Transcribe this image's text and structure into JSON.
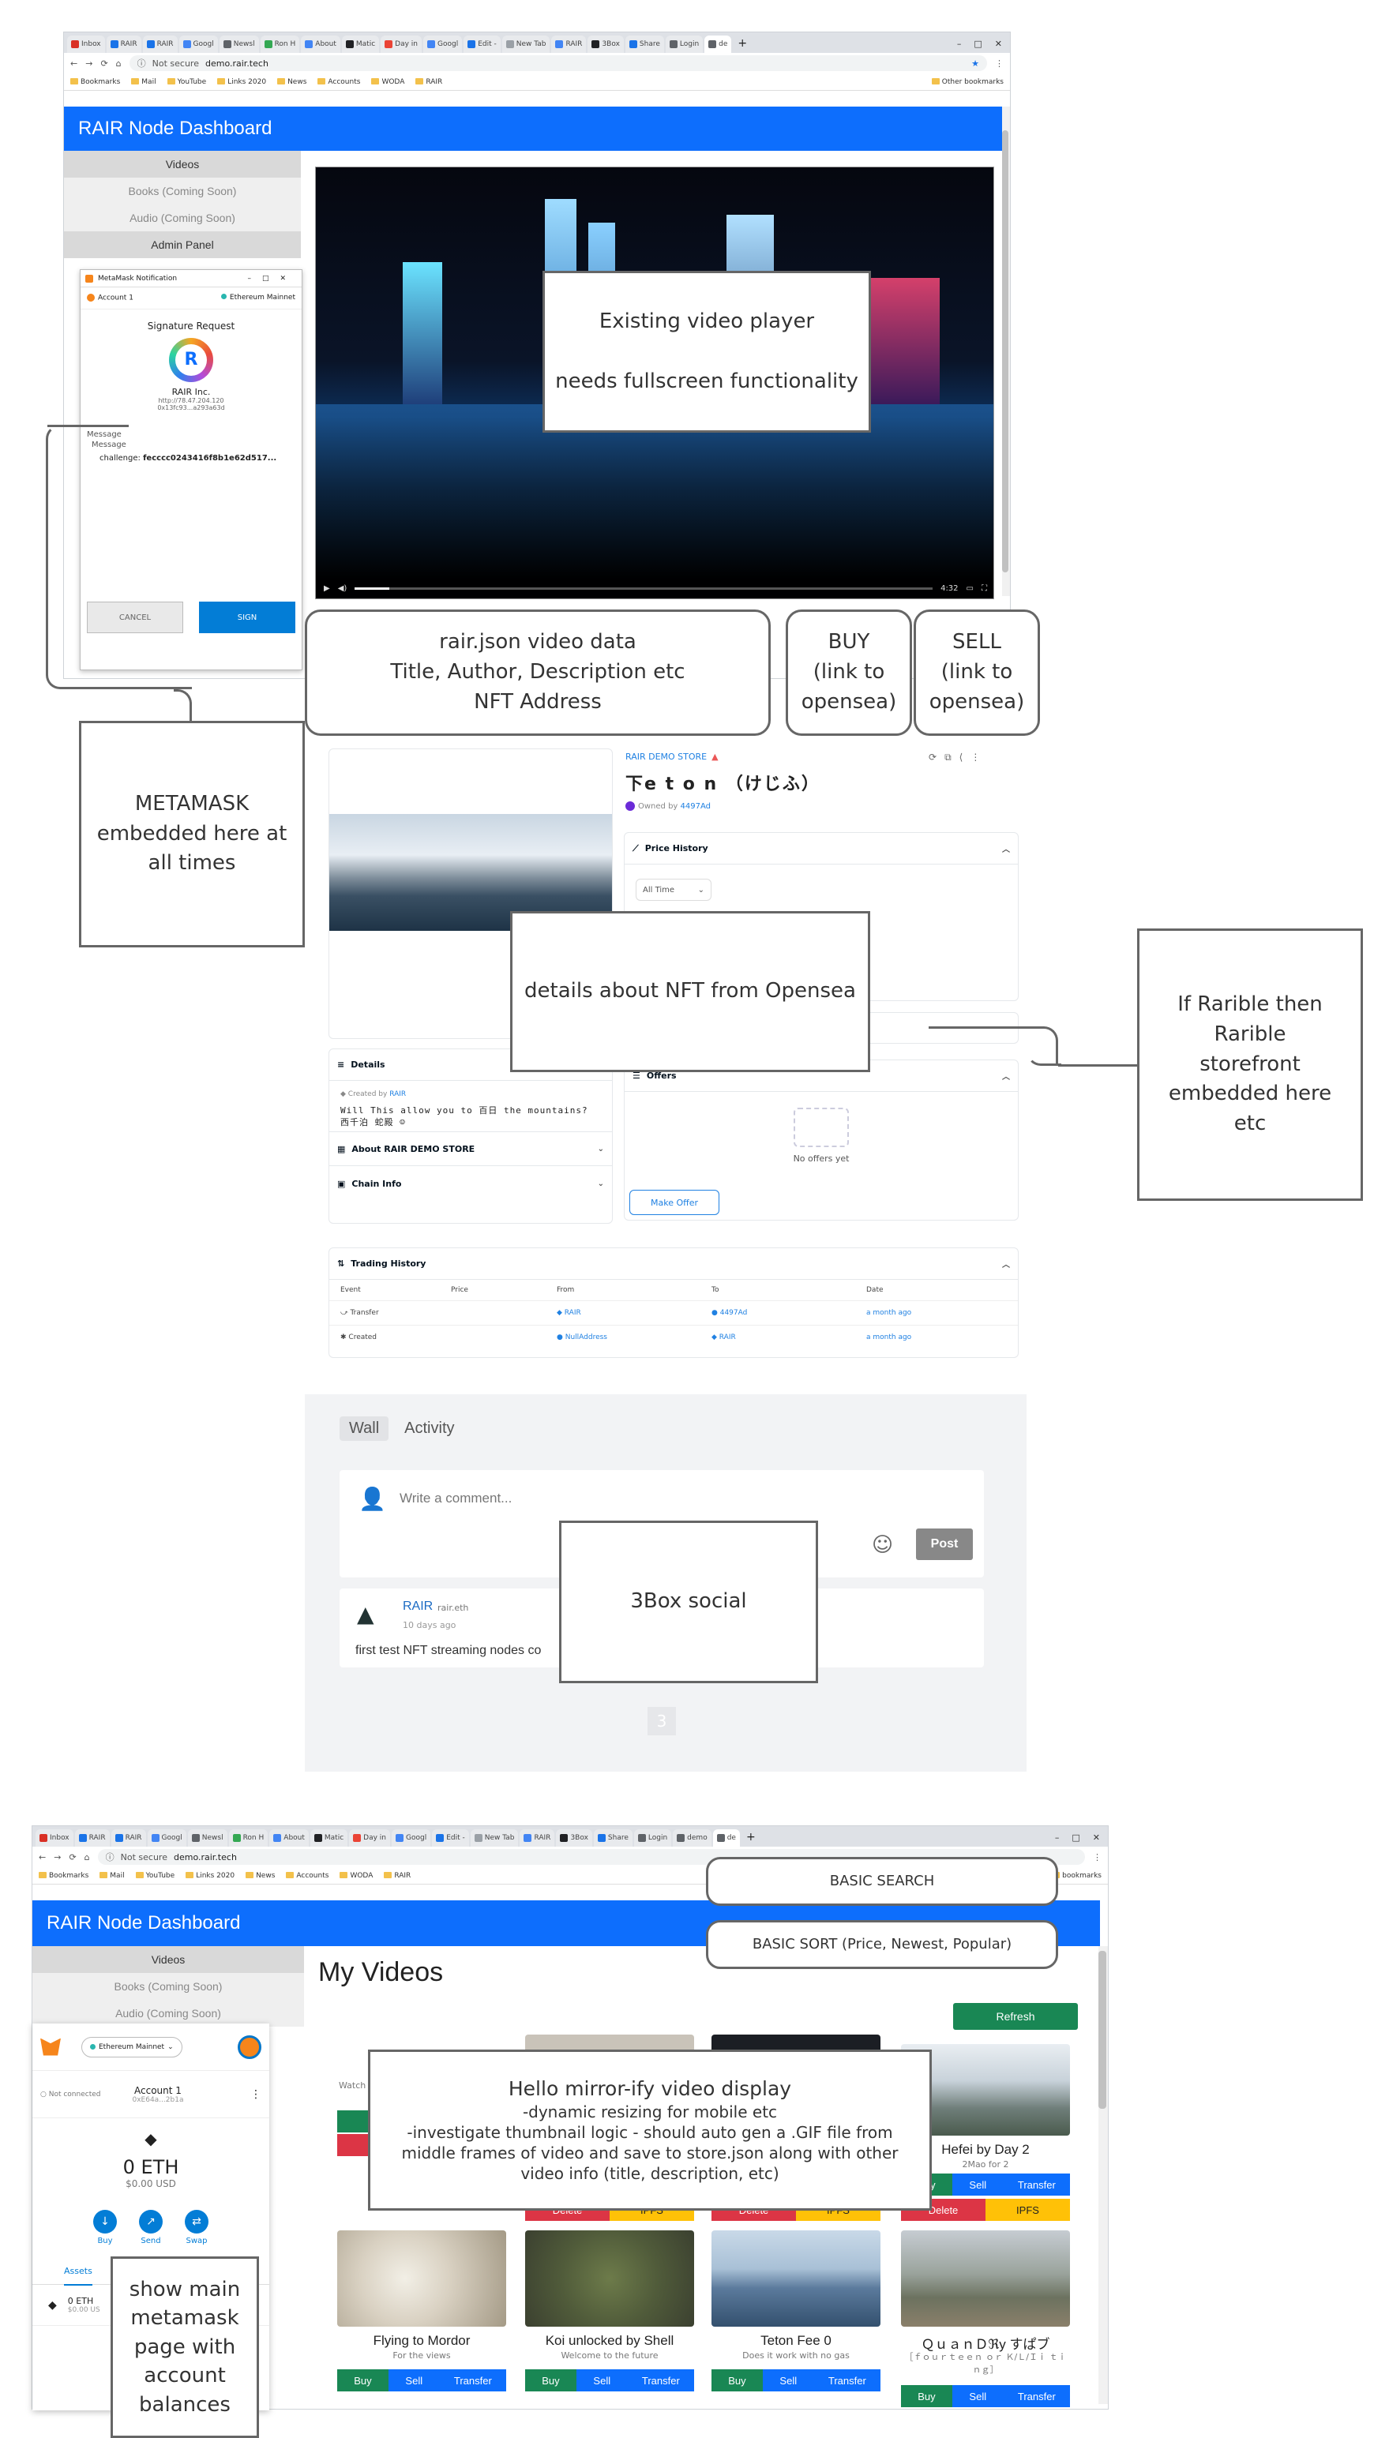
{
  "colors": {
    "rair_blue": "#0d6efd",
    "buy_green": "#198754",
    "delete_red": "#dc3545",
    "ipfs_yellow": "#ffc107",
    "callout_border": "#666666"
  },
  "browser1": {
    "tabs": [
      "Inbox",
      "RAIR",
      "RAIR",
      "Googl",
      "Newsl",
      "Ron H",
      "About",
      "Matic",
      "Day in",
      "Googl",
      "Edit -",
      "New Tab",
      "RAIR",
      "3Box",
      "Share",
      "Login",
      "de"
    ],
    "url_prefix": "Not secure",
    "url": "demo.rair.tech",
    "bookmarks": [
      "Bookmarks",
      "Mail",
      "YouTube",
      "Links 2020",
      "News",
      "Accounts",
      "WODA",
      "RAIR"
    ],
    "other_bookmarks": "Other bookmarks"
  },
  "dashboard": {
    "title": "RAIR Node Dashboard",
    "nav": [
      "Videos",
      "Books (Coming Soon)",
      "Audio (Coming Soon)",
      "Admin Panel"
    ]
  },
  "metamask_popup": {
    "window_title": "MetaMask Notification",
    "account": "Account 1",
    "network": "Ethereum Mainnet",
    "heading": "Signature Request",
    "org": "RAIR Inc.",
    "origin": "http://78.47.204.120",
    "address": "0x13fc93...a293a63d",
    "message_label": "Message",
    "message_sub": "Message",
    "challenge_key": "challenge:",
    "challenge_val": "fecccc0243416f8b1e62d517...",
    "cancel": "CANCEL",
    "sign": "SIGN"
  },
  "video_player": {
    "time": "4:32"
  },
  "callouts": {
    "video_player": [
      "Existing video player",
      "needs fullscreen functionality"
    ],
    "rair_json": [
      "rair.json video data",
      "Title, Author, Description etc",
      "NFT Address"
    ],
    "buy": [
      "BUY",
      "(link to",
      "opensea)"
    ],
    "sell": [
      "SELL",
      "(link to",
      "opensea)"
    ],
    "metamask": [
      "METAMASK",
      "embedded here at",
      "all times"
    ],
    "opensea": "details about NFT from Opensea",
    "rarible": [
      "If Rarible then",
      "Rarible",
      "storefront",
      "embedded here",
      "etc"
    ],
    "threebox": "3Box social",
    "basic_search": "BASIC SEARCH",
    "basic_sort": "BASIC SORT (Price, Newest, Popular)",
    "mirror": [
      "Hello mirror-ify video display",
      "-dynamic resizing for mobile etc",
      "-investigate thumbnail logic - should auto gen a .GIF file from",
      "middle frames of video and save to store.json along with other",
      "video info (title, description, etc)"
    ],
    "main_metamask": [
      "show main",
      "metamask",
      "page with",
      "account",
      "balances"
    ]
  },
  "opensea": {
    "store": "RAIR DEMO STORE",
    "nft_title": "下e t o n  （けじふ）",
    "owned_by": "Owned by",
    "owner": "4497Ad",
    "price_history": "Price History",
    "all_time": "All Time",
    "offers": "Offers",
    "no_offers": "No offers yet",
    "make_offer": "Make Offer",
    "details": "Details",
    "created_by": "Created by",
    "creator": "RAIR",
    "description": "Will This allow you to 百日 the mountains? 西千泊 蛇殿 ☺",
    "about": "About RAIR DEMO STORE",
    "chain_info": "Chain Info",
    "trading_history": "Trading History",
    "columns": [
      "Event",
      "Price",
      "From",
      "To",
      "Date"
    ],
    "rows": [
      {
        "event": "Transfer",
        "price": "",
        "from": "RAIR",
        "to": "4497Ad",
        "date": "a month ago"
      },
      {
        "event": "Created",
        "price": "",
        "from": "NullAddress",
        "to": "RAIR",
        "date": "a month ago"
      }
    ]
  },
  "threebox": {
    "tabs": [
      "Wall",
      "Activity"
    ],
    "comment_placeholder": "Write a comment...",
    "post": "Post",
    "author": "RAIR",
    "author_handle": "rair.eth",
    "time": "10 days ago",
    "text": "first test NFT streaming nodes co",
    "page": "3"
  },
  "browser2": {
    "tabs": [
      "Inbox",
      "RAIR",
      "RAIR",
      "Googl",
      "Newsl",
      "Ron H",
      "About",
      "Matic",
      "Day in",
      "Googl",
      "Edit -",
      "New Tab",
      "RAIR",
      "3Box",
      "Share",
      "Login",
      "demo",
      "de"
    ],
    "url_prefix": "Not secure",
    "url": "demo.rair.tech",
    "bookmarks": [
      "Bookmarks",
      "Mail",
      "YouTube",
      "Links 2020",
      "News",
      "Accounts",
      "WODA",
      "RAIR"
    ],
    "other_bookmarks": "bookmarks"
  },
  "myvideos": {
    "heading": "My Videos",
    "refresh": "Refresh",
    "watch": "Watch",
    "row1_right": {
      "title": "Hefei by Day 2",
      "sub": "2Mao for 2"
    },
    "videos": [
      {
        "title": "Flying to Mordor",
        "sub": "For the views"
      },
      {
        "title": "Koi unlocked by Shell",
        "sub": "Welcome to the future"
      },
      {
        "title": "Teton Fee 0",
        "sub": "Does it work with no gas"
      },
      {
        "title": "ＱｕａｎＤℜу すぱブ",
        "sub": "［ｆｏｕｒｔｅｅｎ ｏｒ Ｋ/Ｌ/Ｉｉ ｔｉｎｇ］"
      }
    ],
    "buttons": {
      "buy": "Buy",
      "sell": "Sell",
      "transfer": "Transfer",
      "delete": "Delete",
      "ipfs": "IPFS"
    }
  },
  "metamask_ext": {
    "network": "Ethereum Mainnet",
    "not_connected": "Not connected",
    "account": "Account 1",
    "address": "0xE64a...2b1a",
    "balance": "0 ETH",
    "usd": "$0.00 USD",
    "actions": [
      "Buy",
      "Send",
      "Swap"
    ],
    "assets_tab": "Assets",
    "asset_eth": "0 ETH",
    "asset_usd": "$0.00 US"
  }
}
